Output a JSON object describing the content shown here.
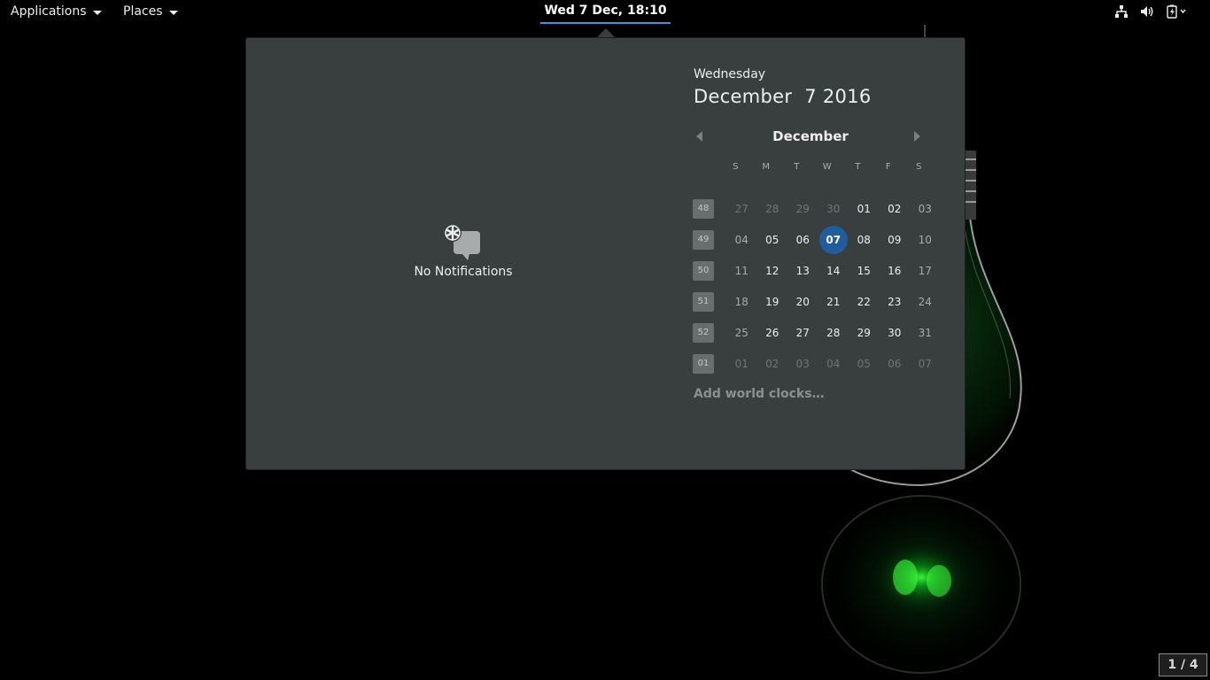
{
  "topbar": {
    "applications_label": "Applications",
    "places_label": "Places",
    "clock": "Wed  7 Dec, 18:10",
    "tray_icons": [
      "network-wired-icon",
      "volume-icon",
      "battery-charging-icon"
    ]
  },
  "notifications": {
    "empty_label": "No Notifications",
    "icon": "chat-bubble-asterisk-icon"
  },
  "date_header": {
    "day_name": "Wednesday",
    "full_date": "December  7 2016"
  },
  "calendar": {
    "month": "December",
    "weekdays": [
      "S",
      "M",
      "T",
      "W",
      "T",
      "F",
      "S"
    ],
    "weeks": [
      {
        "num": "48",
        "days": [
          "27",
          "28",
          "29",
          "30",
          "01",
          "02",
          "03"
        ]
      },
      {
        "num": "49",
        "days": [
          "04",
          "05",
          "06",
          "07",
          "08",
          "09",
          "10"
        ]
      },
      {
        "num": "50",
        "days": [
          "11",
          "12",
          "13",
          "14",
          "15",
          "16",
          "17"
        ]
      },
      {
        "num": "51",
        "days": [
          "18",
          "19",
          "20",
          "21",
          "22",
          "23",
          "24"
        ]
      },
      {
        "num": "52",
        "days": [
          "25",
          "26",
          "27",
          "28",
          "29",
          "30",
          "31"
        ]
      },
      {
        "num": "01",
        "days": [
          "01",
          "02",
          "03",
          "04",
          "05",
          "06",
          "07"
        ]
      }
    ],
    "today": "07",
    "accent_color": "#215d9c"
  },
  "world_clocks_label": "Add world clocks…",
  "workspace_indicator": "1 / 4"
}
